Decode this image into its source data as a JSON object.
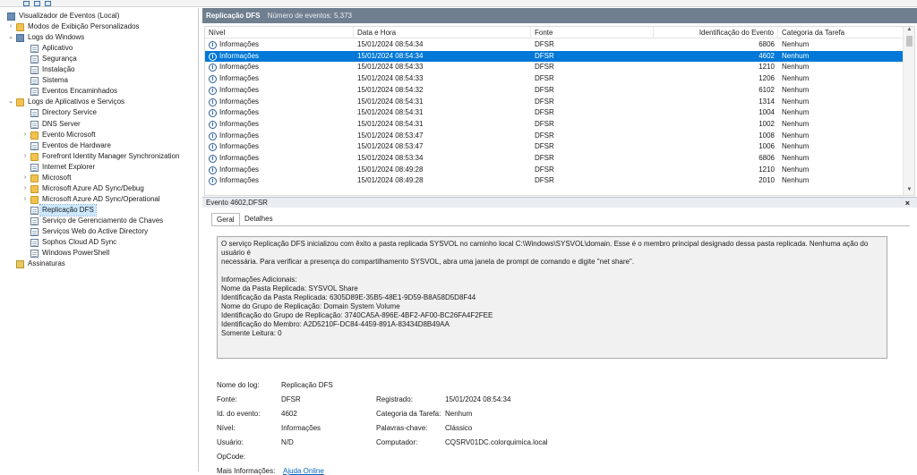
{
  "toolbar": {
    "icons": [
      "back-arrow-icon",
      "forward-arrow-icon",
      "folder-icon",
      "console-icon",
      "help-icon"
    ]
  },
  "sidebar": {
    "items": [
      {
        "label": "Visualizador de Eventos (Local)",
        "icon": "event-viewer-icon",
        "arrow": ""
      },
      {
        "label": "Modos de Exibição Personalizados",
        "icon": "folder-icon",
        "arrow": "›"
      },
      {
        "label": "Logs do Windows",
        "icon": "windows-logs-icon",
        "arrow": "⌄"
      },
      {
        "label": "Aplicativo",
        "icon": "log-icon",
        "arrow": ""
      },
      {
        "label": "Segurança",
        "icon": "log-icon",
        "arrow": ""
      },
      {
        "label": "Instalação",
        "icon": "log-icon",
        "arrow": ""
      },
      {
        "label": "Sistema",
        "icon": "log-icon",
        "arrow": ""
      },
      {
        "label": "Eventos Encaminhados",
        "icon": "log-icon",
        "arrow": ""
      },
      {
        "label": "Logs de Aplicativos e Serviços",
        "icon": "folder-icon",
        "arrow": "⌄"
      },
      {
        "label": "Directory Service",
        "icon": "log-icon",
        "arrow": ""
      },
      {
        "label": "DNS Server",
        "icon": "log-icon",
        "arrow": ""
      },
      {
        "label": "Evento Microsoft",
        "icon": "folder-icon",
        "arrow": "›"
      },
      {
        "label": "Eventos de Hardware",
        "icon": "log-icon",
        "arrow": ""
      },
      {
        "label": "Forefront Identity Manager Synchronization",
        "icon": "folder-icon",
        "arrow": "›"
      },
      {
        "label": "Internet Explorer",
        "icon": "log-icon",
        "arrow": ""
      },
      {
        "label": "Microsoft",
        "icon": "folder-icon",
        "arrow": "›"
      },
      {
        "label": "Microsoft Azure AD Sync/Debug",
        "icon": "folder-icon",
        "arrow": "›"
      },
      {
        "label": "Microsoft Azure AD Sync/Operational",
        "icon": "folder-icon",
        "arrow": "›"
      },
      {
        "label": "Replicação DFS",
        "icon": "log-icon",
        "arrow": "",
        "selected": true
      },
      {
        "label": "Serviço de Gerenciamento de Chaves",
        "icon": "log-icon",
        "arrow": ""
      },
      {
        "label": "Serviços Web do Active Directory",
        "icon": "log-icon",
        "arrow": ""
      },
      {
        "label": "Sophos Cloud AD Sync",
        "icon": "log-icon",
        "arrow": ""
      },
      {
        "label": "Windows PowerShell",
        "icon": "log-icon",
        "arrow": ""
      },
      {
        "label": "Assinaturas",
        "icon": "subscriptions-icon",
        "arrow": ""
      }
    ]
  },
  "main": {
    "title": "Replicação DFS",
    "count": "Número de eventos: 5.373",
    "columns": [
      "Nível",
      "Data e Hora",
      "Fonte",
      "Identificação do Evento",
      "Categoria da Tarefa"
    ],
    "rows": [
      {
        "level": "Informações",
        "date": "15/01/2024 08:54:34",
        "source": "DFSR",
        "id": "6806",
        "category": "Nenhum"
      },
      {
        "level": "Informações",
        "date": "15/01/2024 08:54:34",
        "source": "DFSR",
        "id": "4602",
        "category": "Nenhum",
        "selected": true
      },
      {
        "level": "Informações",
        "date": "15/01/2024 08:54:33",
        "source": "DFSR",
        "id": "1210",
        "category": "Nenhum"
      },
      {
        "level": "Informações",
        "date": "15/01/2024 08:54:33",
        "source": "DFSR",
        "id": "1206",
        "category": "Nenhum"
      },
      {
        "level": "Informações",
        "date": "15/01/2024 08:54:32",
        "source": "DFSR",
        "id": "6102",
        "category": "Nenhum"
      },
      {
        "level": "Informações",
        "date": "15/01/2024 08:54:31",
        "source": "DFSR",
        "id": "1314",
        "category": "Nenhum"
      },
      {
        "level": "Informações",
        "date": "15/01/2024 08:54:31",
        "source": "DFSR",
        "id": "1004",
        "category": "Nenhum"
      },
      {
        "level": "Informações",
        "date": "15/01/2024 08:54:31",
        "source": "DFSR",
        "id": "1002",
        "category": "Nenhum"
      },
      {
        "level": "Informações",
        "date": "15/01/2024 08:53:47",
        "source": "DFSR",
        "id": "1008",
        "category": "Nenhum"
      },
      {
        "level": "Informações",
        "date": "15/01/2024 08:53:47",
        "source": "DFSR",
        "id": "1006",
        "category": "Nenhum"
      },
      {
        "level": "Informações",
        "date": "15/01/2024 08:53:34",
        "source": "DFSR",
        "id": "6806",
        "category": "Nenhum"
      },
      {
        "level": "Informações",
        "date": "15/01/2024 08:49:28",
        "source": "DFSR",
        "id": "1210",
        "category": "Nenhum"
      },
      {
        "level": "Informações",
        "date": "15/01/2024 08:49:28",
        "source": "DFSR",
        "id": "2010",
        "category": "Nenhum"
      }
    ]
  },
  "detail": {
    "title": "Evento 4602,DFSR",
    "close": "×",
    "tabs": [
      "Geral",
      "Detalhes"
    ],
    "description": [
      "O serviço Replicação DFS inicializou com êxito a pasta replicada SYSVOL no caminho local C:\\Windows\\SYSVOL\\domain. Esse é o membro principal designado dessa pasta replicada. Nenhuma ação do usuário é",
      "necessária. Para verificar a presença do compartilhamento SYSVOL, abra uma janela de prompt de comando e digite \"net share\".",
      "",
      "Informações Adicionais:",
      "Nome da Pasta Replicada: SYSVOL Share",
      "Identificação da Pasta Replicada: 6305D89E-35B5-48E1-9D59-B8A58D5D8F44",
      "Nome do Grupo de Replicação: Domain System Volume",
      "Identificação do Grupo de Replicação: 3740CA5A-896E-4BF2-AF00-BC26FA4F2FEE",
      "Identificação do Membro: A2D5210F-DC84-4459-891A-83434D8B49AA",
      "Somente Leitura: 0"
    ],
    "fields": {
      "log_name_label": "Nome do log:",
      "log_name": "Replicação DFS",
      "source_label": "Fonte:",
      "source": "DFSR",
      "registered_label": "Registrado:",
      "registered": "15/01/2024 08:54:34",
      "event_id_label": "Id. do evento:",
      "event_id": "4602",
      "task_category_label": "Categoria da Tarefa:",
      "task_category": "Nenhum",
      "level_label": "Nível:",
      "level": "Informações",
      "keywords_label": "Palavras-chave:",
      "keywords": "Clássico",
      "user_label": "Usuário:",
      "user": "N/D",
      "computer_label": "Computador:",
      "computer": "CQSRV01DC.colorquimica.local",
      "opcode_label": "OpCode:",
      "opcode": "",
      "more_info_label": "Mais Informações:",
      "more_info_link": "Ajuda Online"
    }
  }
}
